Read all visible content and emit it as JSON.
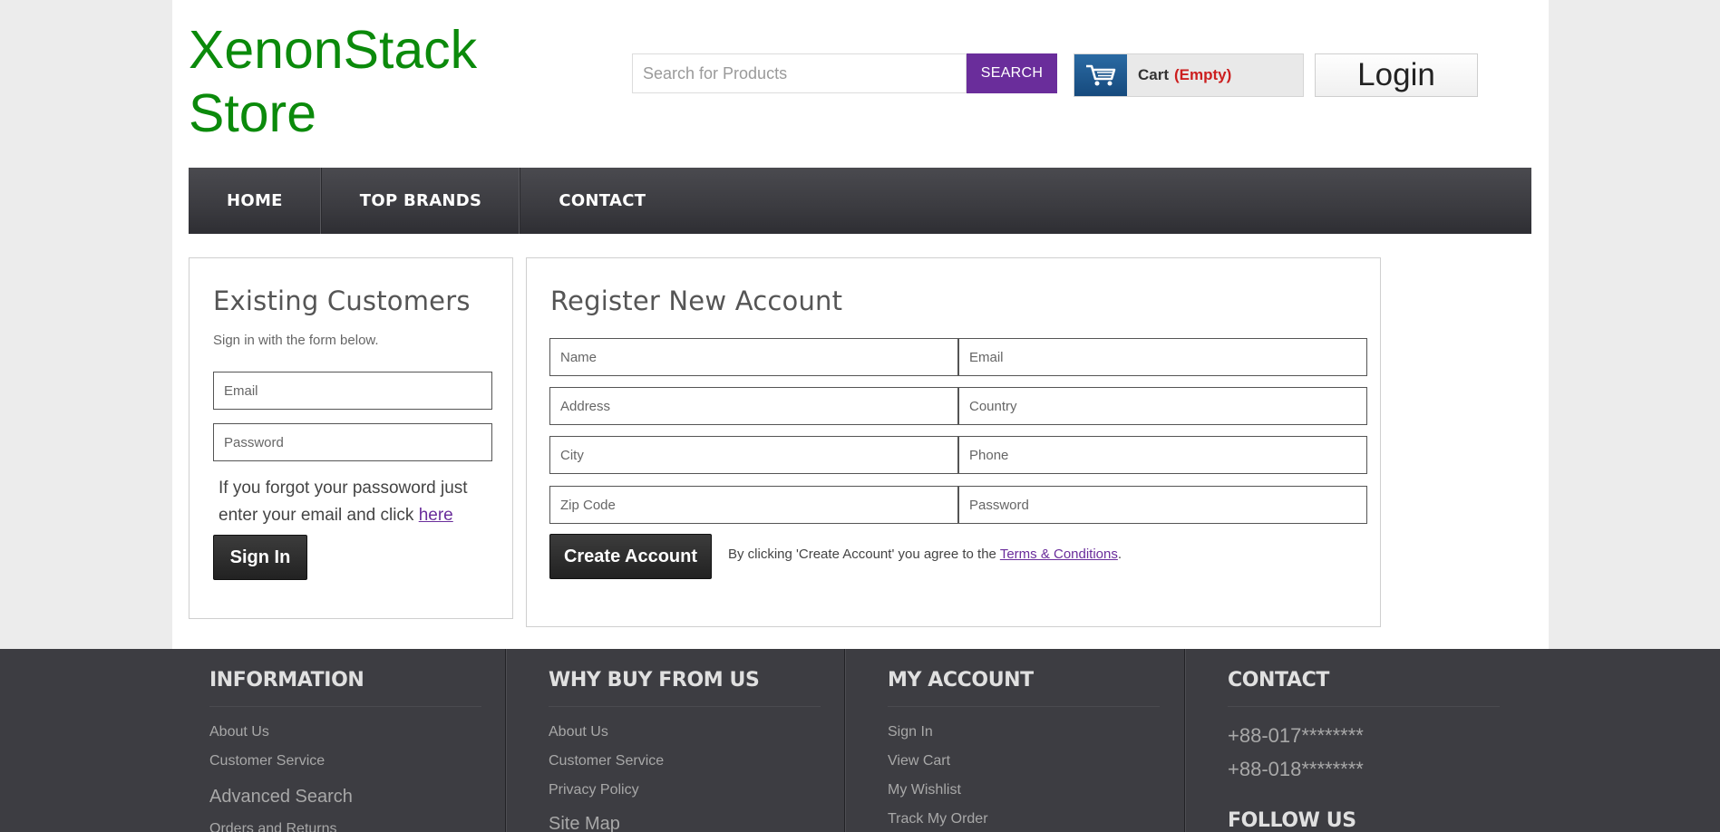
{
  "header": {
    "logo_line1": "XenonStack",
    "logo_line2": "Store",
    "search_placeholder": "Search for Products",
    "search_button": "SEARCH",
    "cart_label": "Cart",
    "cart_status": "(Empty)",
    "login_label": "Login"
  },
  "nav": {
    "items": [
      "HOME",
      "TOP BRANDS",
      "CONTACT"
    ]
  },
  "existing": {
    "title": "Existing Customers",
    "subtitle": "Sign in with the form below.",
    "email_placeholder": "Email",
    "password_placeholder": "Password",
    "forgot_text": "If you forgot your passoword just enter your email and click",
    "forgot_link": "here",
    "sign_in": "Sign In"
  },
  "register": {
    "title": "Register New Account",
    "fields": [
      "Name",
      "Email",
      "Address",
      "Country",
      "City",
      "Phone",
      "Zip Code",
      "Password"
    ],
    "create_button": "Create Account",
    "terms_prefix": "By clicking 'Create Account' you agree to the",
    "terms_link": "Terms & Conditions",
    "terms_suffix": "."
  },
  "footer": {
    "information": {
      "heading": "INFORMATION",
      "links": [
        "About Us",
        "Customer Service",
        "Advanced Search",
        "Orders and Returns"
      ]
    },
    "why_buy": {
      "heading": "WHY BUY FROM US",
      "links": [
        "About Us",
        "Customer Service",
        "Privacy Policy",
        "Site Map"
      ]
    },
    "my_account": {
      "heading": "MY ACCOUNT",
      "links": [
        "Sign In",
        "View Cart",
        "My Wishlist",
        "Track My Order"
      ]
    },
    "contact": {
      "heading": "CONTACT",
      "phones": [
        "+88-017********",
        "+88-018********"
      ],
      "follow_heading": "FOLLOW US"
    }
  },
  "colors": {
    "logo": "#0b8a0b",
    "search_button": "#6a2d9b",
    "cart_empty": "#cc1f1f",
    "nav_bg": "#3b3b40",
    "footer_bg": "#3d3d42"
  }
}
